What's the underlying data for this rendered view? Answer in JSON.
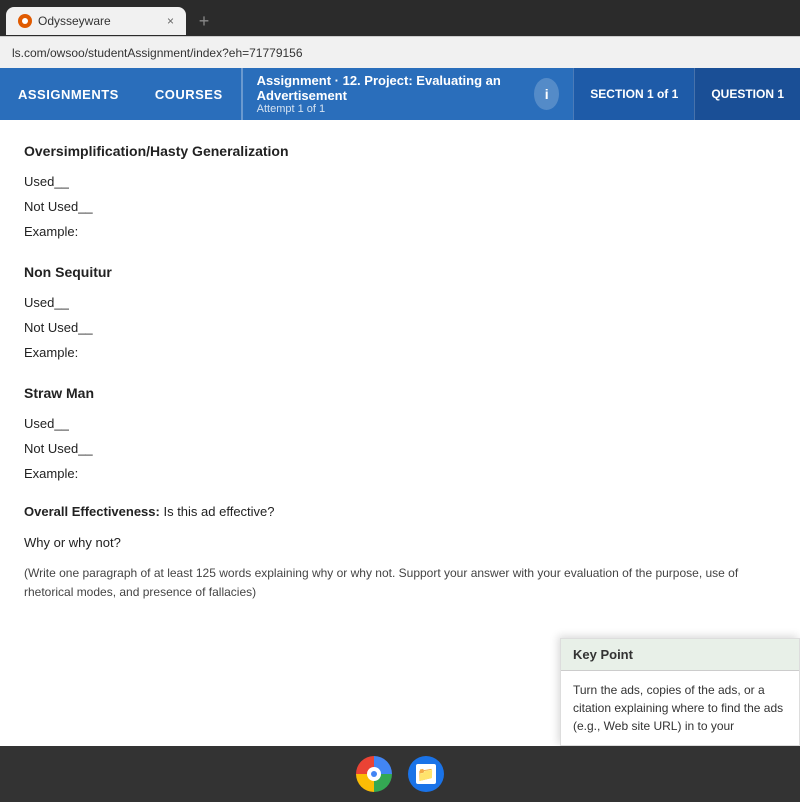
{
  "browser": {
    "tab_label": "Odysseyware",
    "address": "ls.com/owsoo/studentAssignment/index?eh=71779156",
    "tab_close": "×",
    "tab_new": "+"
  },
  "nav": {
    "assignments_label": "ASSIGNMENTS",
    "courses_label": "COURSES",
    "assignment_title": "Assignment  · 12. Project: Evaluating an Advertisement",
    "assignment_attempt": "Attempt 1 of 1",
    "info_icon": "i",
    "section_label": "SECTION 1 of 1",
    "question_label": "QUESTION 1"
  },
  "content": {
    "section1_heading": "Oversimplification/Hasty Generalization",
    "used1": "Used__",
    "not_used1": "Not Used__",
    "example1": "Example:",
    "section2_heading": "Non Sequitur",
    "used2": "Used__",
    "not_used2": "Not Used__",
    "example2": "Example:",
    "section3_heading": "Straw Man",
    "used3": "Used__",
    "not_used3": "Not Used__",
    "example3": "Example:",
    "overall_label": "Overall Effectiveness:",
    "overall_question": " Is this ad effective?",
    "why_label": "Why or why not?",
    "instructions": "(Write one paragraph of at least 125 words explaining why or why not. Support your answer with your evaluation of the purpose, use of rhetorical modes, and presence of fallacies)"
  },
  "key_point": {
    "header": "Key Point",
    "body": "Turn the ads, copies of the ads, or a citation explaining where to find the ads (e.g., Web site URL) in to your"
  }
}
